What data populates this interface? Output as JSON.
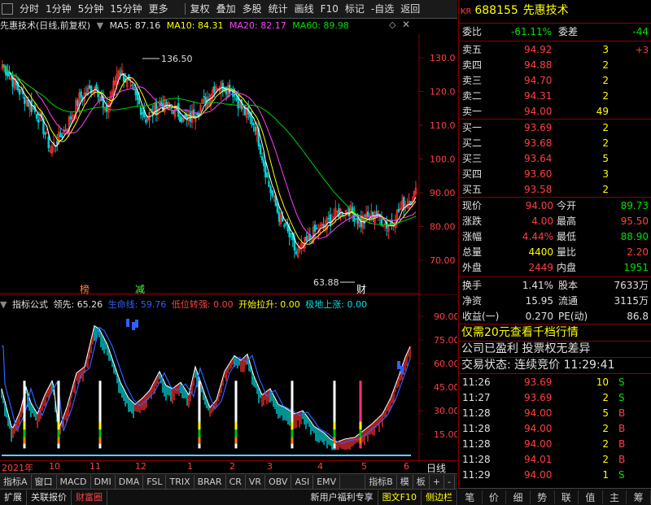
{
  "toolbar": {
    "items": [
      "分时",
      "1分钟",
      "5分钟",
      "15分钟",
      "更多",
      "复权",
      "叠加",
      "多股",
      "统计",
      "画线",
      "F10",
      "标记",
      "-自选",
      "返回"
    ]
  },
  "chart": {
    "title": "先惠技术(日线,前复权)",
    "ma5": "MA5: 87.16",
    "ma10": "MA10: 84.31",
    "ma20": "MA20: 82.17",
    "ma60": "MA60: 89.98",
    "high_label": "136.50",
    "low_label": "63.88",
    "marker_bang": "榜",
    "marker_jian": "减",
    "marker_cai": "财",
    "price_axis": [
      "130.0",
      "120.0",
      "110.0",
      "100.0",
      "90.00",
      "80.00",
      "70.00"
    ],
    "colors": {
      "up": "#ff3030",
      "down": "#00d0d0",
      "ma5": "#ffffff",
      "ma10": "#ffff00",
      "ma20": "#ff40ff",
      "ma60": "#00d000"
    }
  },
  "indicator": {
    "name": "指标公式",
    "lead": "领先: 65.26",
    "life": "生命线: 59.76",
    "low_turn": "低位转强: 0.00",
    "start_rise": "开始拉升: 0.00",
    "bottom_rise": "极地上涨: 0.00",
    "axis": [
      "90.00",
      "75.00",
      "60.00",
      "45.00",
      "30.00",
      "15.00"
    ]
  },
  "time_axis": {
    "labels": [
      "2021年",
      "10",
      "11",
      "12",
      "1",
      "2",
      "3",
      "4",
      "5",
      "6"
    ],
    "period": "日线"
  },
  "tabs": [
    "指标A",
    "窗口",
    "MACD",
    "DMI",
    "DMA",
    "FSL",
    "TRIX",
    "BRAR",
    "CR",
    "VR",
    "OBV",
    "ASI",
    "EMV",
    "",
    "指标B",
    "模",
    "板",
    "+",
    "-"
  ],
  "bottombar": {
    "expand": "扩展",
    "broker": "关联报价",
    "wealth": "财富圈",
    "promo": "新用户福利专享",
    "f10": "图文F10",
    "sidebar": "侧边栏"
  },
  "quote": {
    "kr": "KR",
    "code": "688155",
    "name": "先惠技术",
    "webi_label": "委比",
    "webi": "-61.11%",
    "wecha_label": "委差",
    "wecha": "-44",
    "sells": [
      {
        "label": "卖五",
        "price": "94.92",
        "vol": "3",
        "chg": "+3"
      },
      {
        "label": "卖四",
        "price": "94.88",
        "vol": "2",
        "chg": ""
      },
      {
        "label": "卖三",
        "price": "94.70",
        "vol": "2",
        "chg": ""
      },
      {
        "label": "卖二",
        "price": "94.31",
        "vol": "2",
        "chg": ""
      },
      {
        "label": "卖一",
        "price": "94.00",
        "vol": "49",
        "chg": ""
      }
    ],
    "buys": [
      {
        "label": "买一",
        "price": "93.69",
        "vol": "2"
      },
      {
        "label": "买二",
        "price": "93.68",
        "vol": "2"
      },
      {
        "label": "买三",
        "price": "93.64",
        "vol": "5"
      },
      {
        "label": "买四",
        "price": "93.60",
        "vol": "3"
      },
      {
        "label": "买五",
        "price": "93.58",
        "vol": "2"
      }
    ],
    "stats": [
      {
        "l1": "现价",
        "v1": "94.00",
        "l2": "今开",
        "v2": "89.73"
      },
      {
        "l1": "涨跌",
        "v1": "4.00",
        "l2": "最高",
        "v2": "95.50"
      },
      {
        "l1": "涨幅",
        "v1": "4.44%",
        "l2": "最低",
        "v2": "88.90"
      },
      {
        "l1": "总量",
        "v1": "4400",
        "l2": "量比",
        "v2": "2.20"
      },
      {
        "l1": "外盘",
        "v1": "2449",
        "l2": "内盘",
        "v2": "1951"
      }
    ],
    "extra": [
      {
        "l1": "换手",
        "v1": "1.41%",
        "l2": "股本",
        "v2": "7633万"
      },
      {
        "l1": "净资",
        "v1": "15.95",
        "l2": "流通",
        "v2": "3115万"
      },
      {
        "l1": "收益(一)",
        "v1": "0.270",
        "l2": "PE(动)",
        "v2": "86.8"
      }
    ],
    "promo": "仅需20元查看千档行情",
    "notice": "公司已盈利 投票权无差异",
    "status": "交易状态: 连续竞价 11:29:41",
    "ticks": [
      {
        "time": "11:26",
        "price": "93.69",
        "vol": "10",
        "side": "S"
      },
      {
        "time": "11:27",
        "price": "93.69",
        "vol": "2",
        "side": "S"
      },
      {
        "time": "11:28",
        "price": "94.00",
        "vol": "5",
        "side": "B"
      },
      {
        "time": "11:28",
        "price": "94.00",
        "vol": "2",
        "side": "B"
      },
      {
        "time": "11:28",
        "price": "94.00",
        "vol": "2",
        "side": "B"
      },
      {
        "time": "11:28",
        "price": "94.01",
        "vol": "2",
        "side": "B"
      },
      {
        "time": "11:29",
        "price": "94.00",
        "vol": "1",
        "side": "S"
      }
    ],
    "bottom_tabs": [
      "笔",
      "价",
      "细",
      "势",
      "联",
      "值",
      "主",
      "筹"
    ]
  }
}
